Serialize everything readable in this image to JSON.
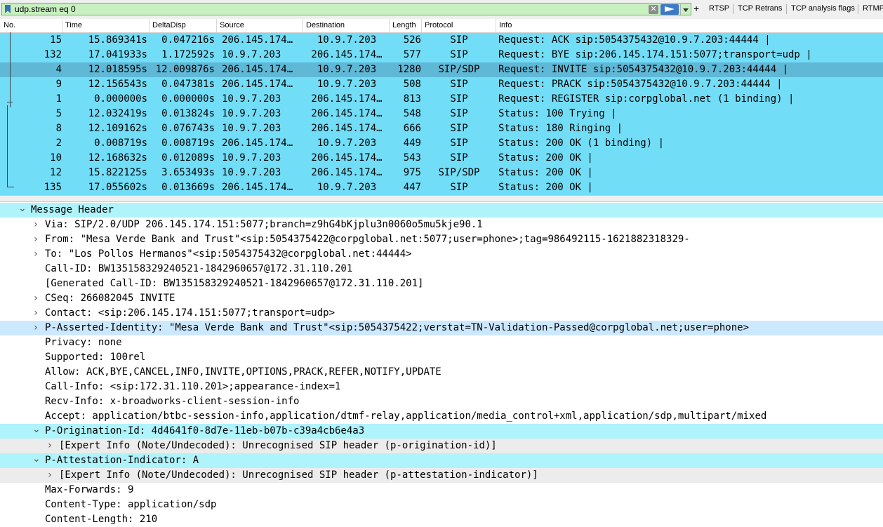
{
  "filter": {
    "value": "udp.stream eq 0",
    "buttons": [
      "RTSP",
      "TCP Retrans",
      "TCP analysis flags",
      "RTMP"
    ]
  },
  "packet_list": {
    "columns": [
      "No.",
      "Time",
      "DeltaDisp",
      "Source",
      "Destination",
      "Length",
      "Protocol",
      "Info"
    ],
    "rows": [
      {
        "no": "15",
        "time": "15.869341s",
        "delta": "0.047216s",
        "src": "206.145.174…",
        "dst": "10.9.7.203",
        "len": "526",
        "proto": "SIP",
        "info": "Request: ACK sip:5054375432@10.9.7.203:44444 |"
      },
      {
        "no": "132",
        "time": "17.041933s",
        "delta": "1.172592s",
        "src": "10.9.7.203",
        "dst": "206.145.174…",
        "len": "577",
        "proto": "SIP",
        "info": "Request: BYE sip:206.145.174.151:5077;transport=udp |"
      },
      {
        "no": "4",
        "time": "12.018595s",
        "delta": "12.009876s",
        "src": "206.145.174…",
        "dst": "10.9.7.203",
        "len": "1280",
        "proto": "SIP/SDP",
        "info": "Request: INVITE sip:5054375432@10.9.7.203:44444 |"
      },
      {
        "no": "9",
        "time": "12.156543s",
        "delta": "0.047381s",
        "src": "206.145.174…",
        "dst": "10.9.7.203",
        "len": "508",
        "proto": "SIP",
        "info": "Request: PRACK sip:5054375432@10.9.7.203:44444 |"
      },
      {
        "no": "1",
        "time": "0.000000s",
        "delta": "0.000000s",
        "src": "10.9.7.203",
        "dst": "206.145.174…",
        "len": "813",
        "proto": "SIP",
        "info": "Request: REGISTER sip:corpglobal.net  (1 binding) |"
      },
      {
        "no": "5",
        "time": "12.032419s",
        "delta": "0.013824s",
        "src": "10.9.7.203",
        "dst": "206.145.174…",
        "len": "548",
        "proto": "SIP",
        "info": "Status: 100 Trying |"
      },
      {
        "no": "8",
        "time": "12.109162s",
        "delta": "0.076743s",
        "src": "10.9.7.203",
        "dst": "206.145.174…",
        "len": "666",
        "proto": "SIP",
        "info": "Status: 180 Ringing |"
      },
      {
        "no": "2",
        "time": "0.008719s",
        "delta": "0.008719s",
        "src": "206.145.174…",
        "dst": "10.9.7.203",
        "len": "449",
        "proto": "SIP",
        "info": "Status: 200 OK  (1 binding) |"
      },
      {
        "no": "10",
        "time": "12.168632s",
        "delta": "0.012089s",
        "src": "10.9.7.203",
        "dst": "206.145.174…",
        "len": "543",
        "proto": "SIP",
        "info": "Status: 200 OK |"
      },
      {
        "no": "12",
        "time": "15.822125s",
        "delta": "3.653493s",
        "src": "10.9.7.203",
        "dst": "206.145.174…",
        "len": "975",
        "proto": "SIP/SDP",
        "info": "Status: 200 OK |"
      },
      {
        "no": "135",
        "time": "17.055602s",
        "delta": "0.013669s",
        "src": "206.145.174…",
        "dst": "10.9.7.203",
        "len": "447",
        "proto": "SIP",
        "info": "Status: 200 OK |"
      }
    ],
    "selected_row": "4"
  },
  "details": [
    {
      "text": "Message Header",
      "expander": "expanded",
      "level": 0,
      "highlight": "cyan"
    },
    {
      "text": "Via: SIP/2.0/UDP 206.145.174.151:5077;branch=z9hG4bKjplu3n0060o5mu5kje90.1",
      "expander": "collapsed",
      "level": 1,
      "highlight": ""
    },
    {
      "text": "From: \"Mesa Verde Bank and Trust\"<sip:5054375422@corpglobal.net:5077;user=phone>;tag=986492115-1621882318329-",
      "expander": "collapsed",
      "level": 1,
      "highlight": ""
    },
    {
      "text": "To: \"Los Pollos Hermanos\"<sip:5054375432@corpglobal.net:44444>",
      "expander": "collapsed",
      "level": 1,
      "highlight": ""
    },
    {
      "text": "Call-ID: BW135158329240521-1842960657@172.31.110.201",
      "expander": "",
      "level": 1,
      "highlight": ""
    },
    {
      "text": "[Generated Call-ID: BW135158329240521-1842960657@172.31.110.201]",
      "expander": "",
      "level": 1,
      "highlight": ""
    },
    {
      "text": "CSeq: 266082045 INVITE",
      "expander": "collapsed",
      "level": 1,
      "highlight": ""
    },
    {
      "text": "Contact: <sip:206.145.174.151:5077;transport=udp>",
      "expander": "collapsed",
      "level": 1,
      "highlight": ""
    },
    {
      "text": "P-Asserted-Identity: \"Mesa Verde Bank and Trust\"<sip:5054375422;verstat=TN-Validation-Passed@corpglobal.net;user=phone>",
      "expander": "collapsed",
      "level": 1,
      "highlight": "blue"
    },
    {
      "text": "Privacy: none",
      "expander": "",
      "level": 1,
      "highlight": ""
    },
    {
      "text": "Supported: 100rel",
      "expander": "",
      "level": 1,
      "highlight": ""
    },
    {
      "text": "Allow: ACK,BYE,CANCEL,INFO,INVITE,OPTIONS,PRACK,REFER,NOTIFY,UPDATE",
      "expander": "",
      "level": 1,
      "highlight": ""
    },
    {
      "text": "Call-Info: <sip:172.31.110.201>;appearance-index=1",
      "expander": "",
      "level": 1,
      "highlight": ""
    },
    {
      "text": "Recv-Info: x-broadworks-client-session-info",
      "expander": "",
      "level": 1,
      "highlight": ""
    },
    {
      "text": "Accept: application/btbc-session-info,application/dtmf-relay,application/media_control+xml,application/sdp,multipart/mixed",
      "expander": "",
      "level": 1,
      "highlight": ""
    },
    {
      "text": "P-Origination-Id: 4d4641f0-8d7e-11eb-b07b-c39a4cb6e4a3",
      "expander": "expanded",
      "level": 1,
      "highlight": "cyan"
    },
    {
      "text": "[Expert Info (Note/Undecoded): Unrecognised SIP header (p-origination-id)]",
      "expander": "collapsed",
      "level": 2,
      "highlight": "grey"
    },
    {
      "text": "P-Attestation-Indicator: A",
      "expander": "expanded",
      "level": 1,
      "highlight": "cyan"
    },
    {
      "text": "[Expert Info (Note/Undecoded): Unrecognised SIP header (p-attestation-indicator)]",
      "expander": "collapsed",
      "level": 2,
      "highlight": "grey"
    },
    {
      "text": "Max-Forwards: 9",
      "expander": "",
      "level": 1,
      "highlight": ""
    },
    {
      "text": "Content-Type: application/sdp",
      "expander": "",
      "level": 1,
      "highlight": ""
    },
    {
      "text": "Content-Length: 210",
      "expander": "",
      "level": 1,
      "highlight": ""
    }
  ]
}
